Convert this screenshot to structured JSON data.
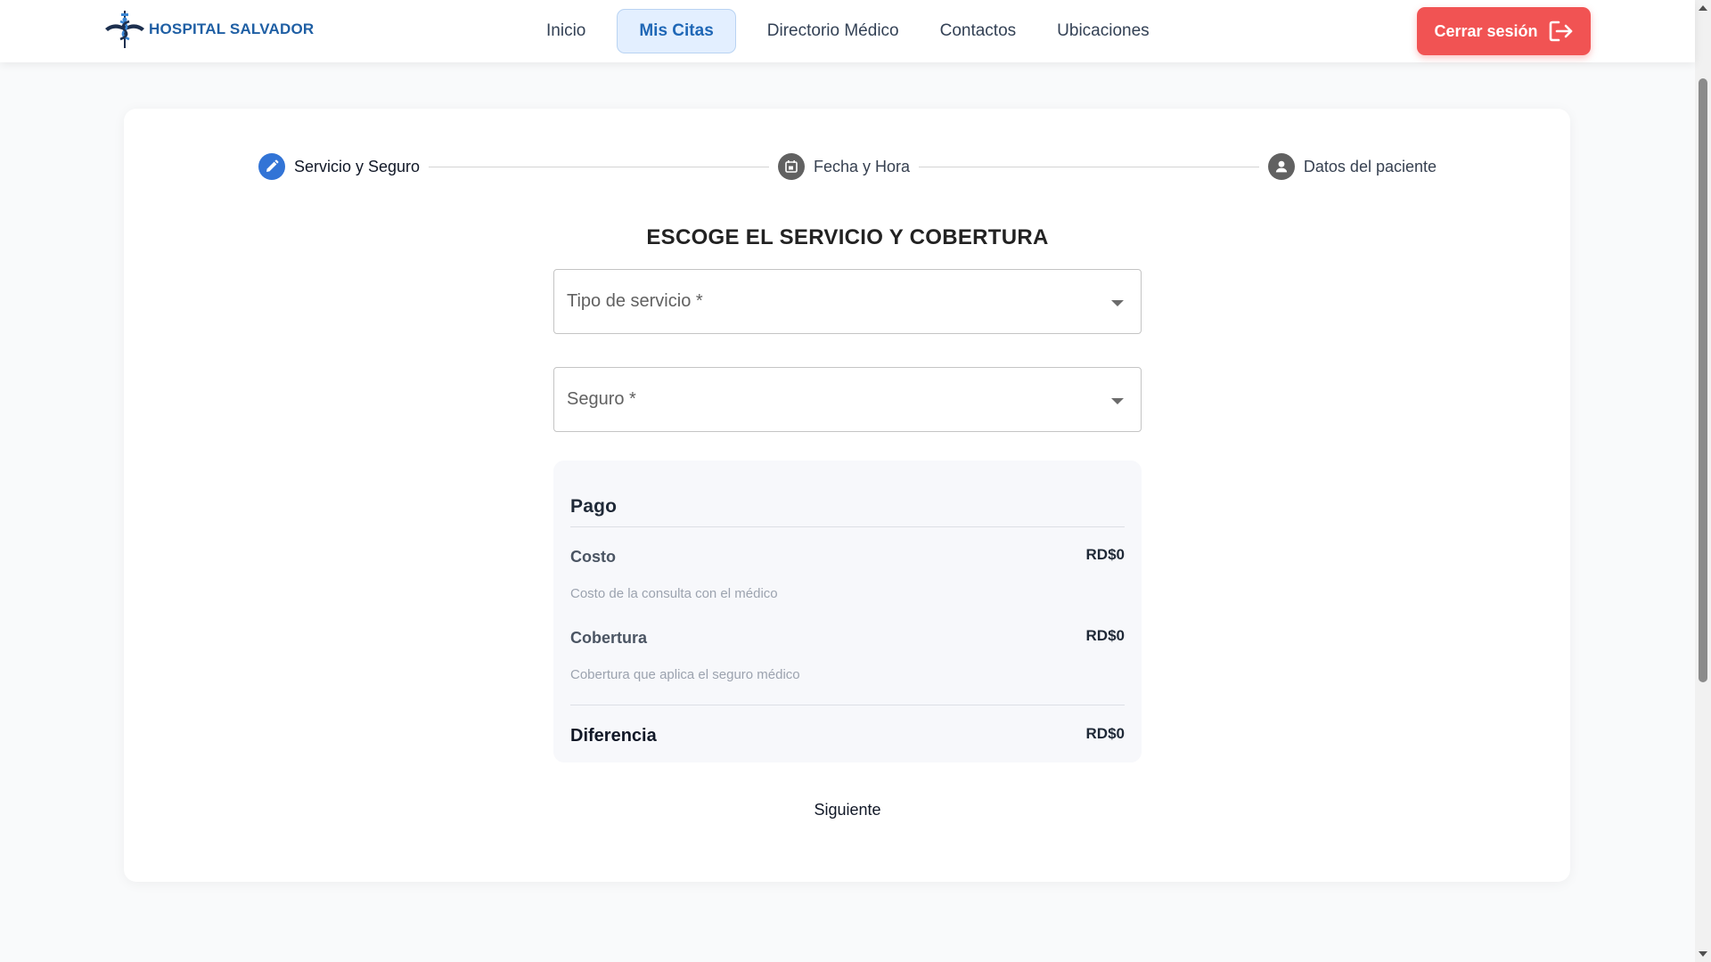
{
  "brand": {
    "name": "HOSPITAL SALVADOR",
    "color": "#1f5fa4"
  },
  "nav": {
    "items": [
      {
        "label": "Inicio",
        "active": false
      },
      {
        "label": "Mis Citas",
        "active": true
      },
      {
        "label": "Directorio Médico",
        "active": false
      },
      {
        "label": "Contactos",
        "active": false
      },
      {
        "label": "Ubicaciones",
        "active": false
      }
    ]
  },
  "header": {
    "logout_label": "Cerrar sesión",
    "logout_color": "#f15353"
  },
  "stepper": {
    "steps": [
      {
        "label": "Servicio y Seguro",
        "icon": "pencil-icon",
        "active": true
      },
      {
        "label": "Fecha y Hora",
        "icon": "calendar-icon",
        "active": false
      },
      {
        "label": "Datos del paciente",
        "icon": "person-icon",
        "active": false
      }
    ]
  },
  "form": {
    "title": "ESCOGE EL SERVICIO Y COBERTURA",
    "service_placeholder": "Tipo de servicio *",
    "insurance_placeholder": "Seguro *"
  },
  "payment": {
    "title": "Pago",
    "cost_label": "Costo",
    "cost_value": "RD$0",
    "cost_desc": "Costo de la consulta con el médico",
    "coverage_label": "Cobertura",
    "coverage_value": "RD$0",
    "coverage_desc": "Cobertura que aplica el seguro médico",
    "difference_label": "Diferencia",
    "difference_value": "RD$0"
  },
  "actions": {
    "next_label": "Siguiente"
  }
}
